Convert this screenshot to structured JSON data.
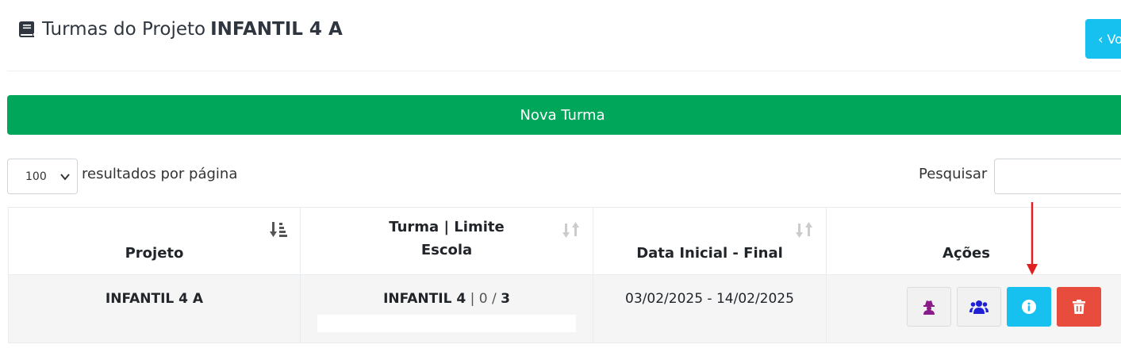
{
  "header": {
    "title_prefix": "Turmas do Projeto",
    "title_project": "INFANTIL 4 A",
    "back_label": "‹ Vo"
  },
  "new_button": {
    "label": "Nova Turma"
  },
  "table_controls": {
    "page_length_value": "100",
    "page_length_label": "resultados por página",
    "search_label": "Pesquisar",
    "search_value": ""
  },
  "table": {
    "columns": [
      {
        "label": "Projeto"
      },
      {
        "label_line1": "Turma | Limite",
        "label_line2": "Escola"
      },
      {
        "label": "Data Inicial - Final"
      },
      {
        "label": "Ações"
      }
    ],
    "rows": [
      {
        "projeto": "INFANTIL 4 A",
        "turma": "INFANTIL 4",
        "sep1": "|",
        "count": "0",
        "slash": "/",
        "limit": "3",
        "datas": "03/02/2025 - 14/02/2025"
      }
    ]
  },
  "colors": {
    "primary_success": "#00a65a",
    "info": "#17c1ef",
    "danger": "#e74c3c",
    "spy_icon": "#8a1c8a",
    "users_icon": "#1f1fd6",
    "annotation_arrow": "#e02020"
  },
  "icons": [
    "book-icon",
    "sort-desc-icon",
    "sort-icon",
    "user-secret-icon",
    "users-icon",
    "info-circle-icon",
    "trash-icon"
  ]
}
